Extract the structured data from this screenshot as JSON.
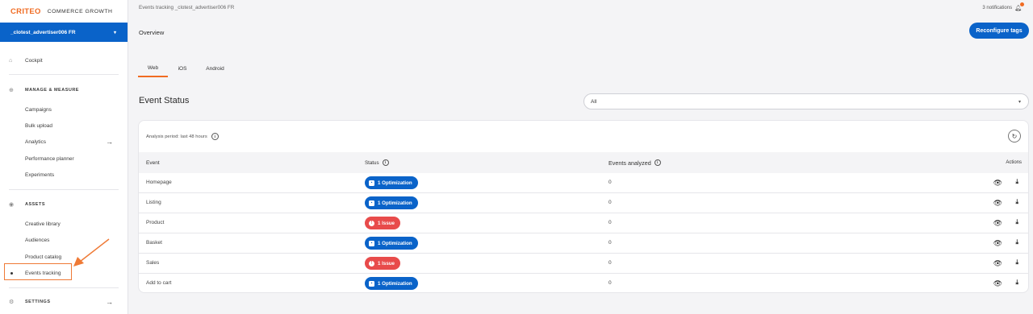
{
  "brand": {
    "logo": "CRITEO",
    "product": "COMMERCE GROWTH"
  },
  "account": {
    "name": "_clotest_advertiser006 FR"
  },
  "nav": {
    "cockpit": "Cockpit",
    "manage_section": "MANAGE & MEASURE",
    "campaigns": "Campaigns",
    "bulk_upload": "Bulk upload",
    "analytics": "Analytics",
    "performance_planner": "Performance planner",
    "experiments": "Experiments",
    "assets_section": "ASSETS",
    "creative_library": "Creative library",
    "audiences": "Audiences",
    "product_catalog": "Product catalog",
    "events_tracking": "Events tracking",
    "settings_section": "SETTINGS"
  },
  "header": {
    "breadcrumb": "Events tracking  _clotest_advertiser006 FR",
    "notifications": "3 notifications"
  },
  "page": {
    "title": "Overview",
    "reconfigure_label": "Reconfigure tags",
    "tabs": [
      "Web",
      "iOS",
      "Android"
    ],
    "active_tab": "Web",
    "section_title": "Event Status",
    "filter_value": "All",
    "analysis_period": "Analysis period: last 48 hours"
  },
  "table": {
    "headers": {
      "event": "Event",
      "status": "Status",
      "analyzed": "Events analyzed",
      "actions": "Actions"
    },
    "rows": [
      {
        "event": "Homepage",
        "status": "1 Optimization",
        "type": "optimization",
        "count": "0"
      },
      {
        "event": "Listing",
        "status": "1 Optimization",
        "type": "optimization",
        "count": "0"
      },
      {
        "event": "Product",
        "status": "1 Issue",
        "type": "issue",
        "count": "0"
      },
      {
        "event": "Basket",
        "status": "1 Optimization",
        "type": "optimization",
        "count": "0"
      },
      {
        "event": "Sales",
        "status": "1 Issue",
        "type": "issue",
        "count": "0"
      },
      {
        "event": "Add to cart",
        "status": "1 Optimization",
        "type": "optimization",
        "count": "0"
      }
    ]
  },
  "colors": {
    "accent": "#0a63c9",
    "brand": "#f06b22",
    "issue": "#e84b4b"
  }
}
